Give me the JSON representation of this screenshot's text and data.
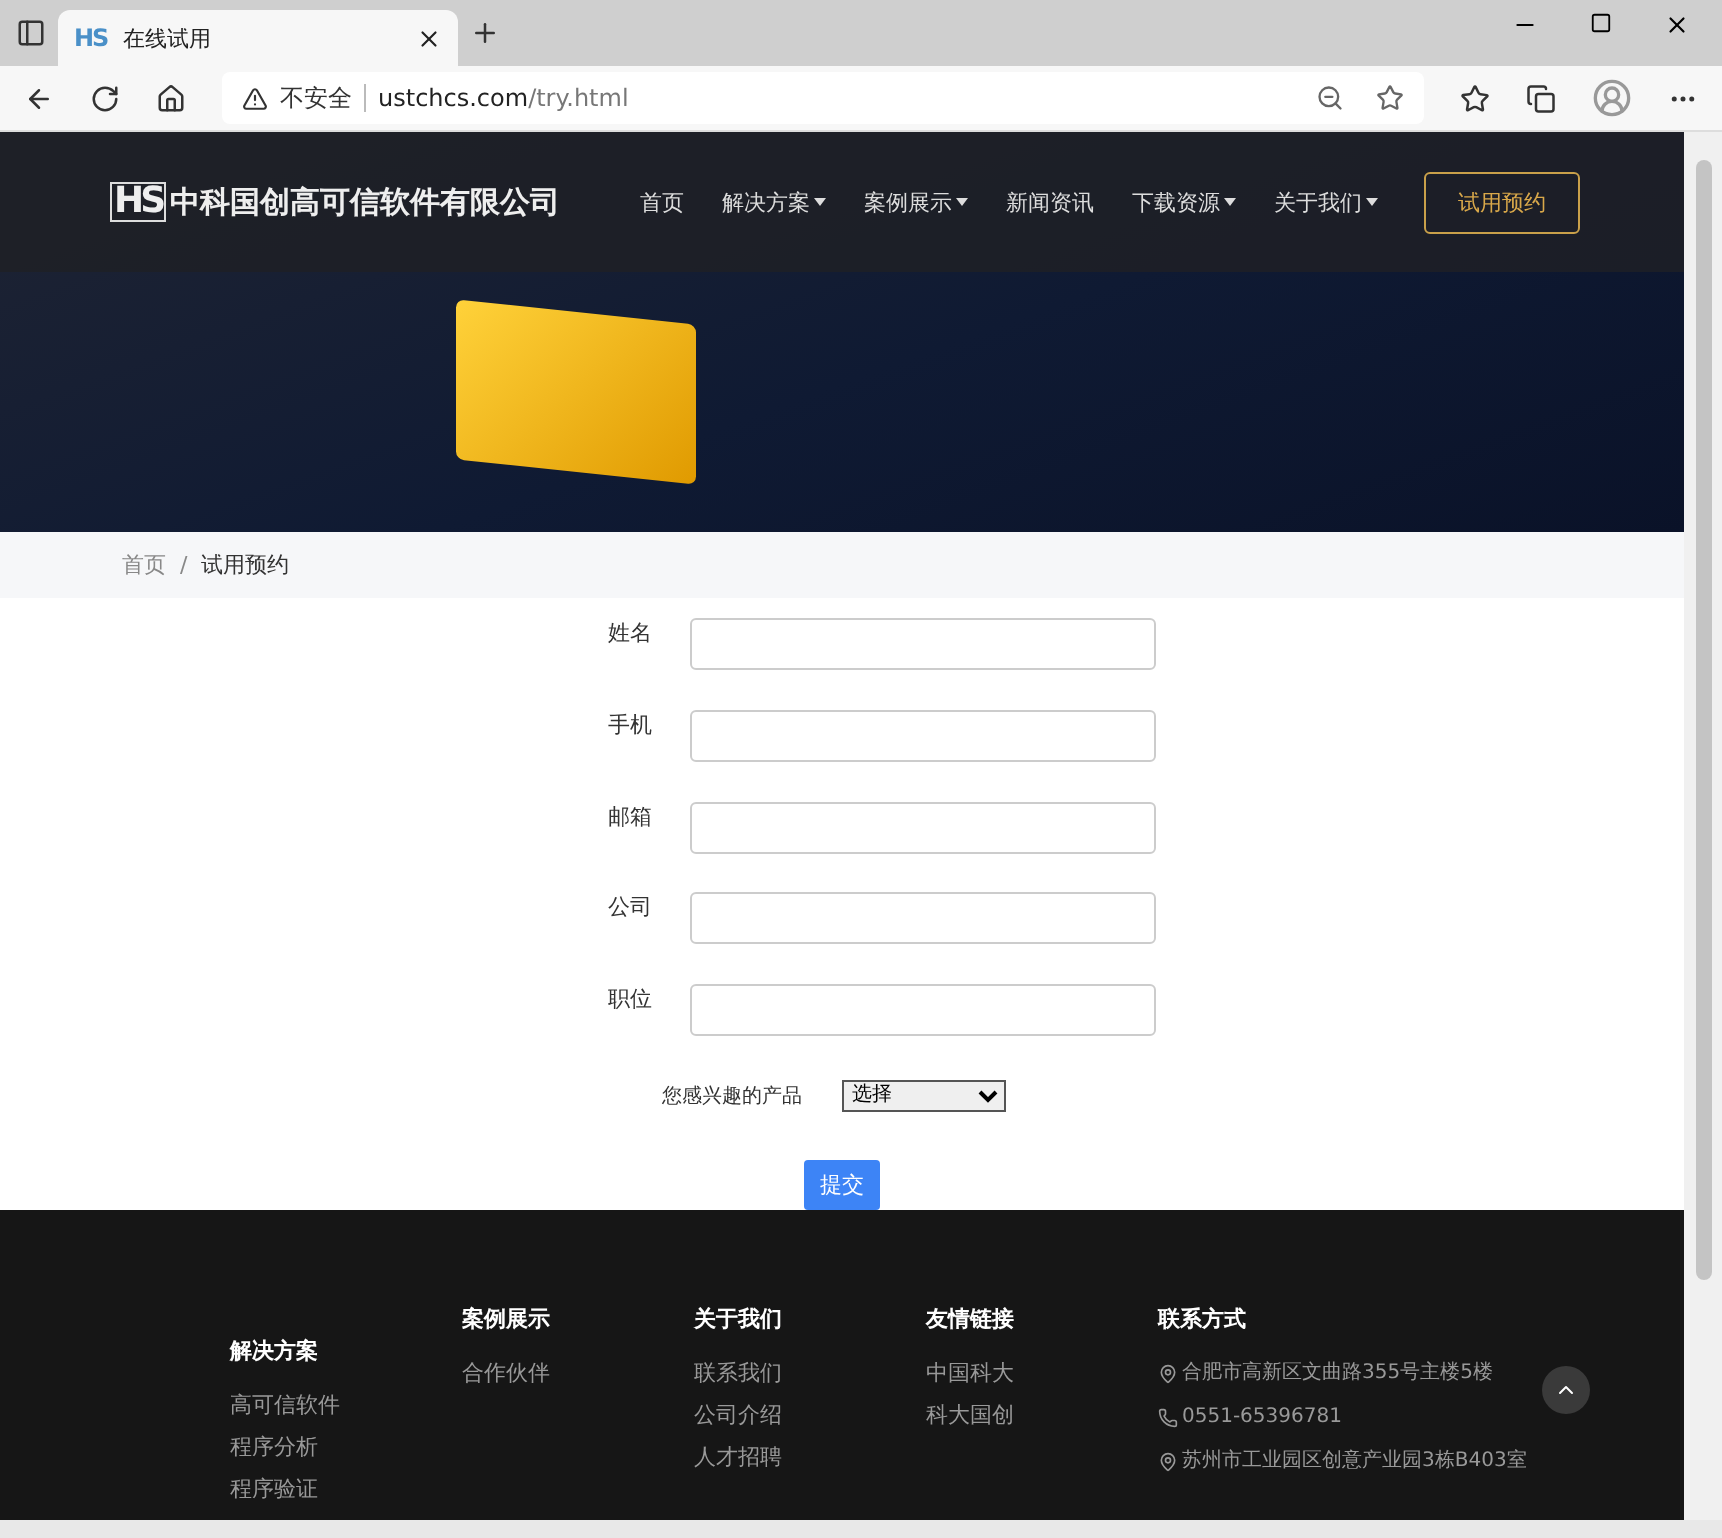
{
  "browser": {
    "tab_logo": "HS",
    "tab_title": "在线试用",
    "security": "不安全",
    "url_host": "ustchcs.com",
    "url_path": "/try.html"
  },
  "header": {
    "logo_mark": "HS",
    "company": "中科国创高可信软件有限公司",
    "nav": [
      {
        "label": "首页",
        "dropdown": false
      },
      {
        "label": "解决方案",
        "dropdown": true
      },
      {
        "label": "案例展示",
        "dropdown": true
      },
      {
        "label": "新闻资讯",
        "dropdown": false
      },
      {
        "label": "下载资源",
        "dropdown": true
      },
      {
        "label": "关于我们",
        "dropdown": true
      }
    ],
    "cta": "试用预约"
  },
  "breadcrumb": [
    {
      "label": "首页",
      "current": false
    },
    {
      "label": "试用预约",
      "current": true
    }
  ],
  "breadcrumb_separator": "/",
  "form": {
    "fields": [
      {
        "label": "姓名"
      },
      {
        "label": "手机"
      },
      {
        "label": "邮箱"
      },
      {
        "label": "公司"
      },
      {
        "label": "职位"
      }
    ],
    "product": {
      "label": "您感兴趣的产品",
      "value": "选择"
    },
    "submit": "提交"
  },
  "footer": {
    "columns": [
      {
        "title": "解决方案",
        "links": [
          "高可信软件",
          "程序分析",
          "程序验证"
        ]
      },
      {
        "title": "案例展示",
        "links": [
          "合作伙伴"
        ]
      },
      {
        "title": "关于我们",
        "links": [
          "联系我们",
          "公司介绍",
          "人才招聘"
        ]
      },
      {
        "title": "友情链接",
        "links": [
          "中国科大",
          "科大国创"
        ]
      }
    ],
    "contact": {
      "title": "联系方式",
      "items": [
        {
          "kind": "location",
          "text": "合肥市高新区文曲路355号主楼5楼"
        },
        {
          "kind": "phone",
          "text": "0551-65396781"
        },
        {
          "kind": "location",
          "text": "苏州市工业园区创意产业园3栋B403室"
        }
      ]
    }
  }
}
